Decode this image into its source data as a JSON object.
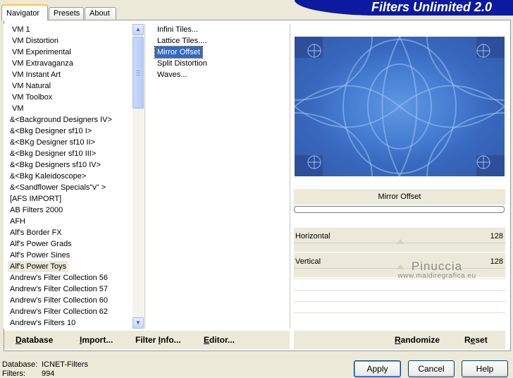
{
  "tabs": [
    "Navigator",
    "Presets",
    "About"
  ],
  "banner_title": "Filters Unlimited 2.0",
  "categories": [
    "VM 1",
    "VM Distortion",
    "VM Experimental",
    "VM Extravaganza",
    "VM Instant Art",
    "VM Natural",
    "VM Toolbox",
    "VM",
    "&<Background Designers IV>",
    "&<Bkg Designer sf10 I>",
    "&<BKg Designer sf10 II>",
    "&<Bkg Designer sf10 III>",
    "&<Bkg Designers sf10 IV>",
    "&<Bkg Kaleidoscope>",
    "&<Sandflower Specials\"v\" >",
    "[AFS IMPORT]",
    "AB Filters 2000",
    "AFH",
    "Alf's Border FX",
    "Alf's Power Grads",
    "Alf's Power Sines",
    "Alf's Power Toys",
    "Andrew's Filter Collection 56",
    "Andrew's Filter Collection 57",
    "Andrew's Filter Collection 60",
    "Andrew's Filter Collection 62",
    "Andrew's Filters 10"
  ],
  "selected_category": "Alf's Power Toys",
  "filters": [
    "Infini Tiles...",
    "Lattice Tiles....",
    "Mirror Offset",
    "Split Distortion",
    "Waves..."
  ],
  "selected_filter": "Mirror Offset",
  "preview_caption": "Mirror Offset",
  "params": [
    {
      "name": "Horizontal",
      "value": "128",
      "level": 0.502
    },
    {
      "name": "Vertical",
      "value": "128",
      "level": 0.502
    }
  ],
  "watermark": {
    "title": "Pinuccia",
    "subtitle": "www.maidiregrafica.eu"
  },
  "toolbar": {
    "database": {
      "underlined": "D",
      "rest": "atabase"
    },
    "import": {
      "pre": "",
      "underlined": "I",
      "rest": "mport..."
    },
    "filter_info": {
      "pre": "Filter ",
      "underlined": "I",
      "rest": "nfo..."
    },
    "editor": {
      "pre": "",
      "underlined": "E",
      "rest": "ditor..."
    },
    "randomize": {
      "underlined": "R",
      "rest": "andomize"
    },
    "reset": {
      "pre": "R",
      "underlined": "e",
      "rest": "set"
    }
  },
  "status": {
    "database_label": "Database:",
    "database_value": "ICNET-Filters",
    "filters_label": "Filters:",
    "filters_value": "994"
  },
  "buttons": {
    "apply": "Apply",
    "cancel": "Cancel",
    "help": "Help"
  },
  "colors": {
    "selection": "#316ac5",
    "banner": "#0b1a9e",
    "dialog_bg": "#ece9d8"
  }
}
